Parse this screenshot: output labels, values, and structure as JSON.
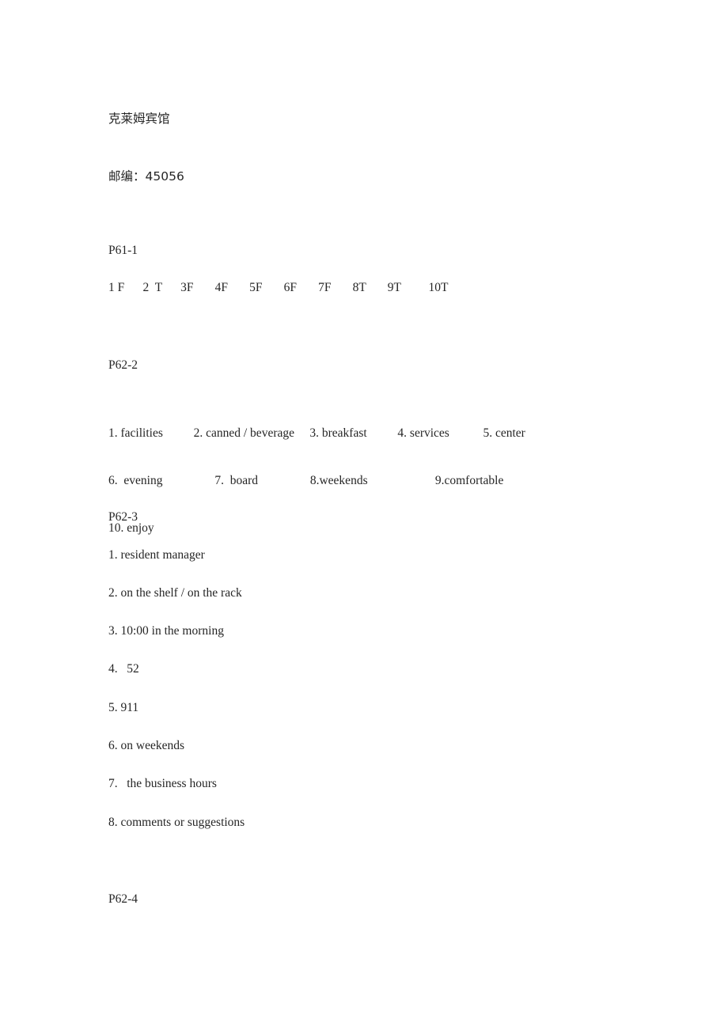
{
  "document": {
    "header": {
      "hotel_name_cn": "克莱姆宾馆",
      "postcode_line_cn": "邮编：45056"
    },
    "sections": [
      {
        "id": "p61-1",
        "heading": "P61-1",
        "answer_row": "1 F      2  T      3F       4F       5F       6F       7F       8T       9T         10T"
      },
      {
        "id": "p62-2",
        "heading": "P62-2",
        "lines": [
          "1. facilities          2. canned / beverage     3. breakfast          4. services           5. center",
          "6.  evening                 7.  board                 8.weekends                      9.comfortable",
          "10. enjoy"
        ]
      },
      {
        "id": "p62-3",
        "heading": "P62-3",
        "items": [
          "1. resident manager",
          "2. on the shelf / on the rack",
          "3. 10:00 in the morning",
          "4.   52",
          "5. 911",
          "6. on weekends",
          "7.   the business hours",
          "8. comments or suggestions"
        ]
      },
      {
        "id": "p62-4",
        "heading": "P62-4"
      }
    ]
  }
}
